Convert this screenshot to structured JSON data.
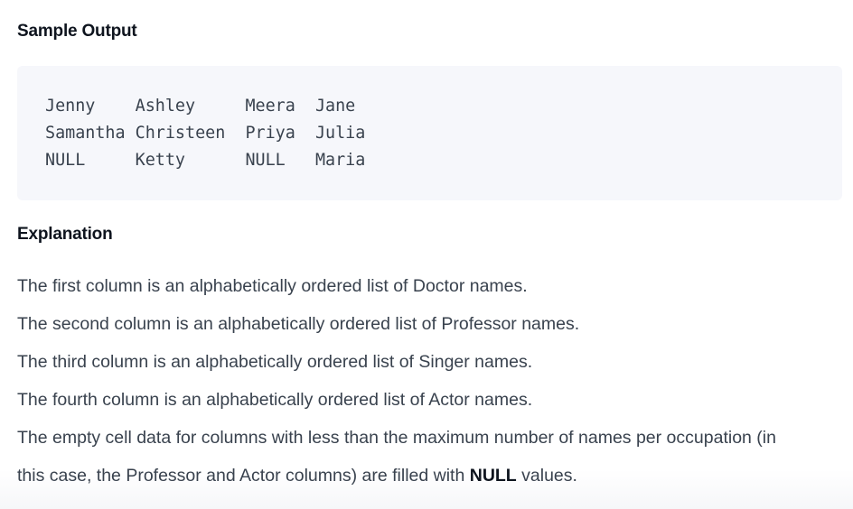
{
  "sample_output": {
    "heading": "Sample Output",
    "lines": [
      "Jenny    Ashley     Meera  Jane",
      "Samantha Christeen  Priya  Julia",
      "NULL     Ketty      NULL   Maria"
    ]
  },
  "explanation": {
    "heading": "Explanation",
    "paragraphs": [
      "The first column is an alphabetically ordered list of Doctor names.",
      "The second column is an alphabetically ordered list of Professor names.",
      "The third column is an alphabetically ordered list of Singer names.",
      "The fourth column is an alphabetically ordered list of Actor names.",
      "The empty cell data for columns with less than the maximum number of names per occupation (in"
    ],
    "last_line": {
      "before": "this case, the Professor and Actor columns) are filled with ",
      "bold": "NULL",
      "after": " values."
    }
  }
}
